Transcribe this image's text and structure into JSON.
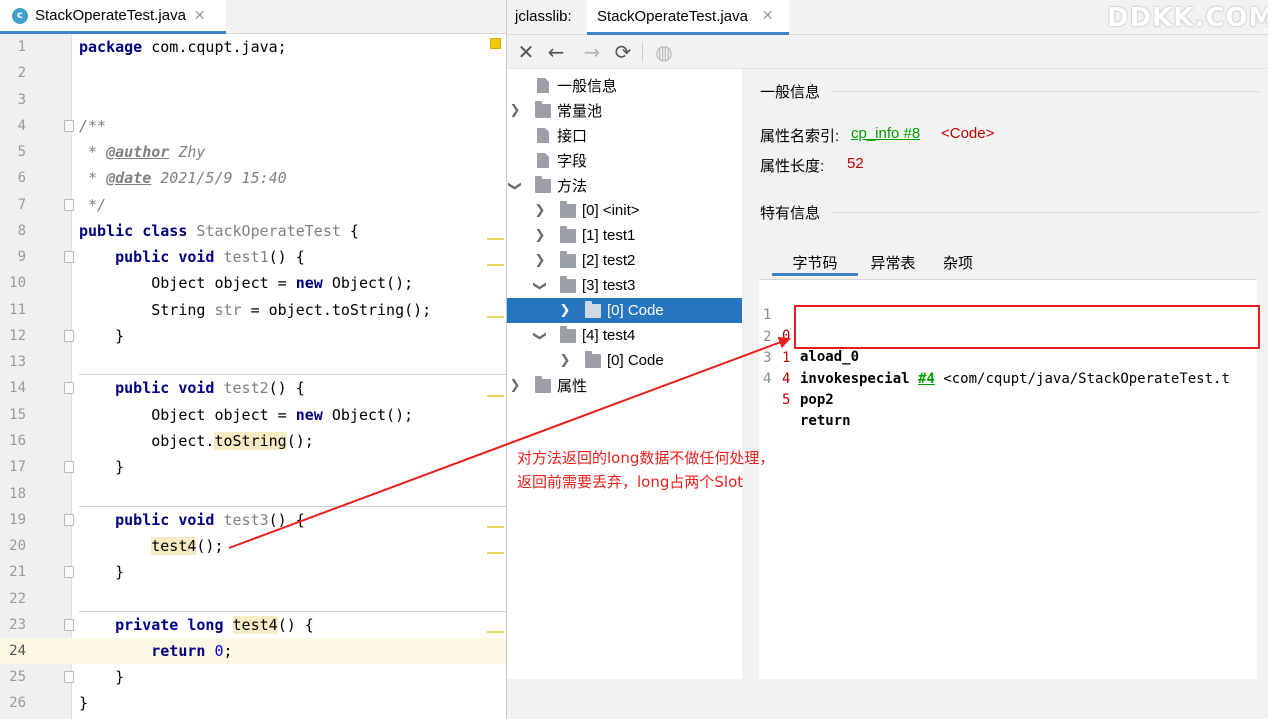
{
  "editor": {
    "tab_label": "StackOperateTest.java",
    "file_badge": "c",
    "close_glyph": "✕",
    "lines": [
      {
        "n": "1"
      },
      {
        "n": "2"
      },
      {
        "n": "3"
      },
      {
        "n": "4"
      },
      {
        "n": "5"
      },
      {
        "n": "6"
      },
      {
        "n": "7"
      },
      {
        "n": "8"
      },
      {
        "n": "9"
      },
      {
        "n": "10"
      },
      {
        "n": "11"
      },
      {
        "n": "12"
      },
      {
        "n": "13"
      },
      {
        "n": "14"
      },
      {
        "n": "15"
      },
      {
        "n": "16"
      },
      {
        "n": "17"
      },
      {
        "n": "18"
      },
      {
        "n": "19"
      },
      {
        "n": "20"
      },
      {
        "n": "21"
      },
      {
        "n": "22"
      },
      {
        "n": "23"
      },
      {
        "n": "24"
      },
      {
        "n": "25"
      },
      {
        "n": "26"
      }
    ],
    "code": {
      "l1_kw": "package",
      "l1_rest": " com.cqupt.java;",
      "l4": "/**",
      "l5_a": " * ",
      "l5_tag": "@author",
      "l5_b": " Zhy",
      "l6_a": " * ",
      "l6_tag": "@date",
      "l6_b": " 2021/5/9 15:40",
      "l7": " */",
      "l8_kw": "public class",
      "l8_name": " StackOperateTest",
      "l8_rest": " {",
      "l9_kw": "    public void",
      "l9_name": " test1",
      "l9_rest": "() {",
      "l10_a": "        Object object = ",
      "l10_kw": "new",
      "l10_b": " Object();",
      "l11_a": "        String ",
      "l11_var": "str",
      "l11_b": " = object.toString();",
      "l12": "    }",
      "l14_kw": "    public void",
      "l14_name": " test2",
      "l14_rest": "() {",
      "l15_a": "        Object object = ",
      "l15_kw": "new",
      "l15_b": " Object();",
      "l16_a": "        object.",
      "l16_hl": "toString",
      "l16_b": "();",
      "l17": "    }",
      "l19_kw": "    public void",
      "l19_name": " test3",
      "l19_rest": "() {",
      "l20_pre": "        ",
      "l20_hl": "test4",
      "l20_b": "();",
      "l21": "    }",
      "l23_kw": "    private long",
      "l23_sp": " ",
      "l23_hl": "test4",
      "l23_rest": "() {",
      "l24_kw": "        return",
      "l24_sp": " ",
      "l24_num": "0",
      "l24_b": ";",
      "l25": "    }",
      "l26": "}"
    }
  },
  "jclasslib": {
    "prefix": "jclasslib:",
    "tab_label": "StackOperateTest.java",
    "close_glyph": "✕",
    "watermark": "DDKK.COM",
    "toolbar": {
      "close": "✕",
      "back": "←",
      "forward": "→",
      "refresh": "⟳",
      "web": "◍"
    },
    "tree": [
      {
        "label": "一般信息"
      },
      {
        "label": "常量池"
      },
      {
        "label": "接口"
      },
      {
        "label": "字段"
      },
      {
        "label": "方法"
      },
      {
        "label": "[0] <init>"
      },
      {
        "label": "[1] test1"
      },
      {
        "label": "[2] test2"
      },
      {
        "label": "[3] test3"
      },
      {
        "label": "[0] Code"
      },
      {
        "label": "[4] test4"
      },
      {
        "label": "[0] Code"
      },
      {
        "label": "属性"
      }
    ],
    "info": {
      "general_title": "一般信息",
      "name_index_label": "属性名索引:",
      "name_index_link": "cp_info #8",
      "name_index_value": "<Code>",
      "length_label": "属性长度:",
      "length_value": "52",
      "specific_title": "特有信息",
      "tabs": [
        "字节码",
        "异常表",
        "杂项"
      ],
      "bytecode": [
        {
          "idx": "1",
          "off": "0",
          "ins": "aload_0",
          "ref": "",
          "arg": ""
        },
        {
          "idx": "2",
          "off": "1",
          "ins": "invokespecial",
          "ref": "#4",
          "arg": "<com/cqupt/java/StackOperateTest.t"
        },
        {
          "idx": "3",
          "off": "4",
          "ins": "pop2",
          "ref": "",
          "arg": ""
        },
        {
          "idx": "4",
          "off": "5",
          "ins": "return",
          "ref": "",
          "arg": ""
        }
      ]
    }
  },
  "annotation": {
    "line1": "对方法返回的long数据不做任何处理，",
    "line2": "返回前需要丢弃，long占两个Slot",
    "color": "#e8201e"
  }
}
